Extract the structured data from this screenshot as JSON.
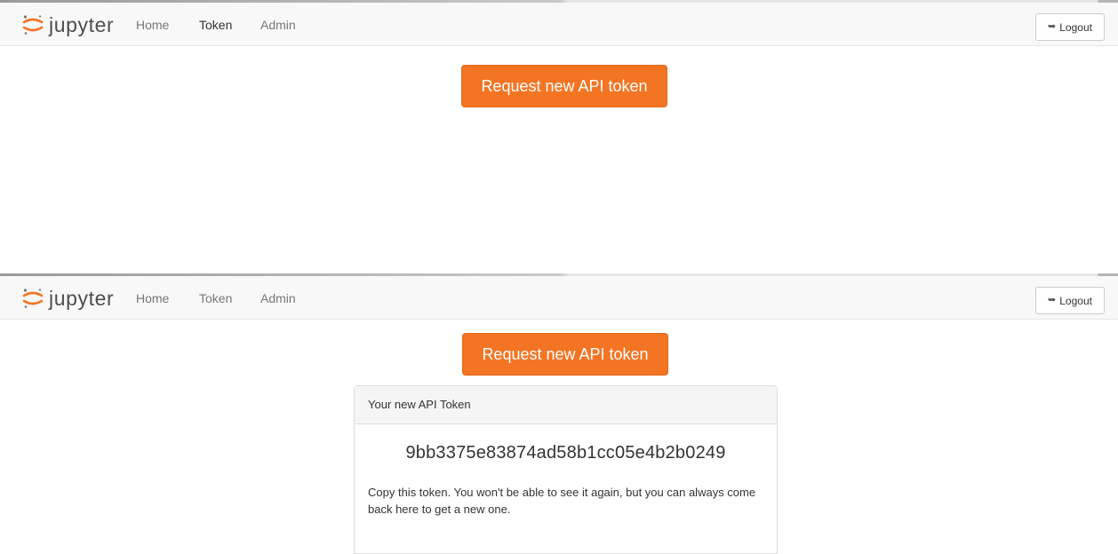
{
  "brand": {
    "wordmark": "jupyter",
    "accent_color": "#f37524"
  },
  "states": [
    {
      "navbar": {
        "links": [
          {
            "label": "Home",
            "active": false
          },
          {
            "label": "Token",
            "active": true
          },
          {
            "label": "Admin",
            "active": false
          }
        ],
        "logout": {
          "icon": "sign-out-icon",
          "label": "Logout"
        }
      },
      "request_button": "Request new API token"
    },
    {
      "navbar": {
        "links": [
          {
            "label": "Home",
            "active": false
          },
          {
            "label": "Token",
            "active": false
          },
          {
            "label": "Admin",
            "active": false
          }
        ],
        "logout": {
          "icon": "sign-out-icon",
          "label": "Logout"
        }
      },
      "request_button": "Request new API token",
      "token_panel": {
        "heading": "Your new API Token",
        "token": "9bb3375e83874ad58b1cc05e4b2b0249",
        "note": "Copy this token. You won't be able to see it again, but you can always come back here to get a new one."
      }
    }
  ]
}
